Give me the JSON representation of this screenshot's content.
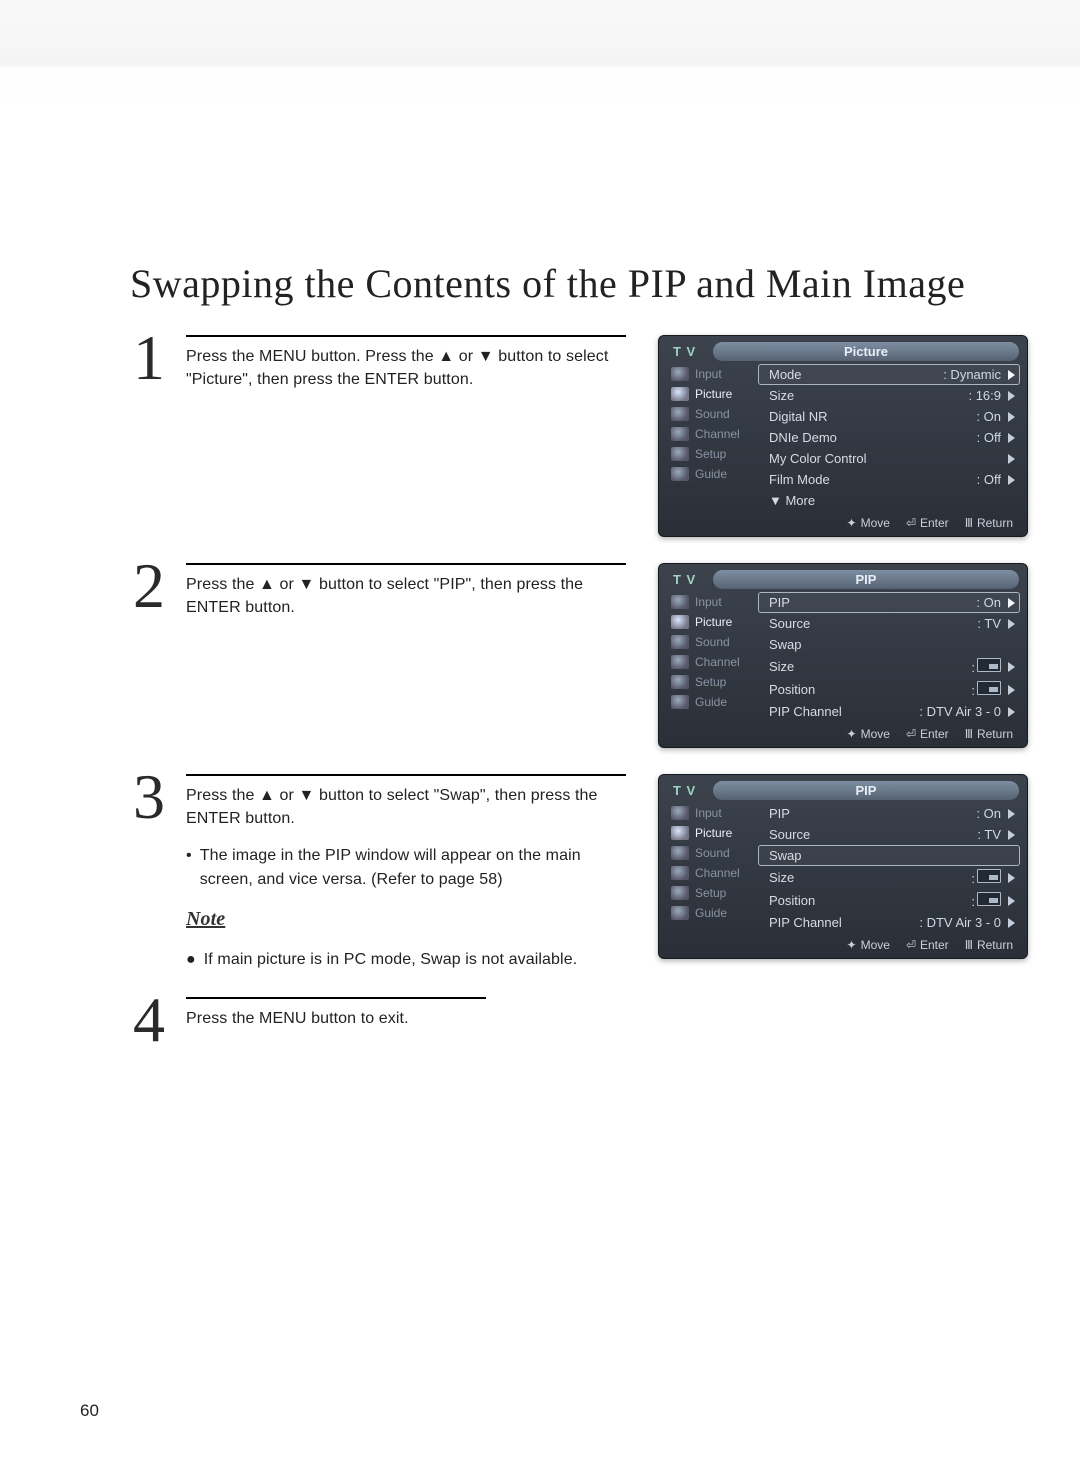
{
  "page": {
    "title": "Swapping the Contents of the PIP and Main Image",
    "number": "60"
  },
  "tri": {
    "up": "▲",
    "down": "▼"
  },
  "steps": {
    "s1": {
      "num": "1",
      "text_a": "Press the MENU button. Press the ",
      "text_b": " or ",
      "text_c": " button to select \"Picture\", then press the ENTER button."
    },
    "s2": {
      "num": "2",
      "text_a": "Press the ",
      "text_b": " or ",
      "text_c": " button to select \"PIP\", then press the ENTER button."
    },
    "s3": {
      "num": "3",
      "text_a": "Press the ",
      "text_b": " or ",
      "text_c": " button to select \"Swap\", then press the ENTER button.",
      "bullet": "The image in the PIP window will appear on the main screen, and vice versa. (Refer to page 58)",
      "note_head": "Note",
      "note_body": "If main picture is in PC mode, Swap is not available."
    },
    "s4": {
      "num": "4",
      "text": "Press the MENU button to exit."
    }
  },
  "osd_common": {
    "tv": "T V",
    "side": [
      "Input",
      "Picture",
      "Sound",
      "Channel",
      "Setup",
      "Guide"
    ],
    "footer": {
      "move": "Move",
      "enter": "Enter",
      "return": "Return"
    }
  },
  "osd1": {
    "header": "Picture",
    "side_active": 1,
    "rows": [
      {
        "label": "Mode",
        "val": ": Dynamic",
        "sel": true
      },
      {
        "label": "Size",
        "val": ": 16:9"
      },
      {
        "label": "Digital NR",
        "val": ": On"
      },
      {
        "label": "DNIe Demo",
        "val": ": Off"
      },
      {
        "label": "My Color Control",
        "val": ""
      },
      {
        "label": "Film Mode",
        "val": ": Off"
      },
      {
        "label": "▼ More",
        "val": "",
        "nocaret": true
      }
    ]
  },
  "osd2": {
    "header": "PIP",
    "side_active": 1,
    "rows": [
      {
        "label": "PIP",
        "val": ": On",
        "sel": true
      },
      {
        "label": "Source",
        "val": ": TV"
      },
      {
        "label": "Swap",
        "val": "",
        "nocaret": true
      },
      {
        "label": "Size",
        "val": ":",
        "icon": true
      },
      {
        "label": "Position",
        "val": ":",
        "icon": true
      },
      {
        "label": "PIP Channel",
        "val": ": DTV Air 3 - 0"
      }
    ]
  },
  "osd3": {
    "header": "PIP",
    "side_active": 1,
    "rows": [
      {
        "label": "PIP",
        "val": ": On"
      },
      {
        "label": "Source",
        "val": ": TV"
      },
      {
        "label": "Swap",
        "val": "",
        "sel": true,
        "nocaret": true
      },
      {
        "label": "Size",
        "val": ":",
        "icon": true
      },
      {
        "label": "Position",
        "val": ":",
        "icon": true
      },
      {
        "label": "PIP Channel",
        "val": ": DTV Air 3 - 0"
      }
    ]
  }
}
